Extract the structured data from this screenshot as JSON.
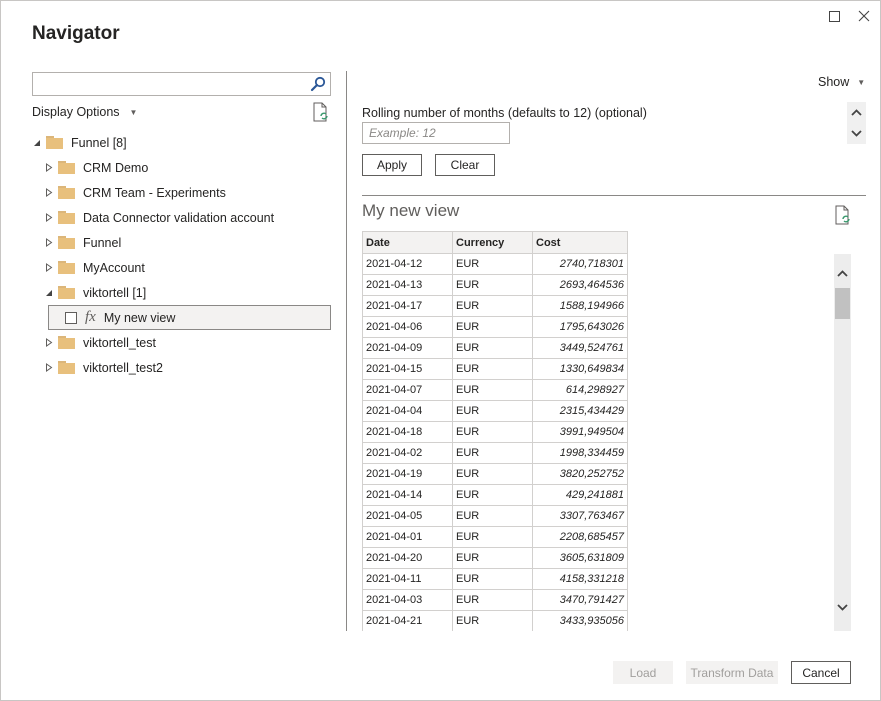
{
  "window": {
    "title": "Navigator",
    "maximize_icon": "maximize-icon",
    "close_icon": "close-icon"
  },
  "left_pane": {
    "search": {
      "value": "",
      "placeholder": "",
      "icon": "search-icon"
    },
    "display_options_label": "Display Options",
    "tree": {
      "root": {
        "label": "Funnel [8]",
        "expanded": true
      },
      "children": [
        {
          "label": "CRM Demo",
          "expanded": false
        },
        {
          "label": "CRM Team - Experiments",
          "expanded": false
        },
        {
          "label": "Data Connector validation account",
          "expanded": false
        },
        {
          "label": "Funnel",
          "expanded": false
        },
        {
          "label": "MyAccount",
          "expanded": false
        },
        {
          "label": "viktortell [1]",
          "expanded": true,
          "items": [
            {
              "label": "My new view",
              "type": "function",
              "checked": false,
              "selected": true
            }
          ]
        },
        {
          "label": "viktortell_test",
          "expanded": false
        },
        {
          "label": "viktortell_test2",
          "expanded": false
        }
      ]
    }
  },
  "right_pane": {
    "show_label": "Show",
    "parameter": {
      "label": "Rolling number of months (defaults to 12) (optional)",
      "value": "",
      "placeholder": "Example: 12"
    },
    "apply_label": "Apply",
    "clear_label": "Clear",
    "preview_title": "My new view",
    "table": {
      "columns": [
        "Date",
        "Currency",
        "Cost"
      ],
      "rows": [
        [
          "2021-04-12",
          "EUR",
          "2740,718301"
        ],
        [
          "2021-04-13",
          "EUR",
          "2693,464536"
        ],
        [
          "2021-04-17",
          "EUR",
          "1588,194966"
        ],
        [
          "2021-04-06",
          "EUR",
          "1795,643026"
        ],
        [
          "2021-04-09",
          "EUR",
          "3449,524761"
        ],
        [
          "2021-04-15",
          "EUR",
          "1330,649834"
        ],
        [
          "2021-04-07",
          "EUR",
          "614,298927"
        ],
        [
          "2021-04-04",
          "EUR",
          "2315,434429"
        ],
        [
          "2021-04-18",
          "EUR",
          "3991,949504"
        ],
        [
          "2021-04-02",
          "EUR",
          "1998,334459"
        ],
        [
          "2021-04-19",
          "EUR",
          "3820,252752"
        ],
        [
          "2021-04-14",
          "EUR",
          "429,241881"
        ],
        [
          "2021-04-05",
          "EUR",
          "3307,763467"
        ],
        [
          "2021-04-01",
          "EUR",
          "2208,685457"
        ],
        [
          "2021-04-20",
          "EUR",
          "3605,631809"
        ],
        [
          "2021-04-11",
          "EUR",
          "4158,331218"
        ],
        [
          "2021-04-03",
          "EUR",
          "3470,791427"
        ],
        [
          "2021-04-21",
          "EUR",
          "3433,935056"
        ]
      ]
    }
  },
  "footer": {
    "load_label": "Load",
    "transform_label": "Transform Data",
    "cancel_label": "Cancel"
  },
  "colors": {
    "folder": "#e8c07d",
    "refresh_accent": "#3a9a6e",
    "disabled_button_bg": "#f3f2f1",
    "disabled_text": "#a19f9d"
  }
}
